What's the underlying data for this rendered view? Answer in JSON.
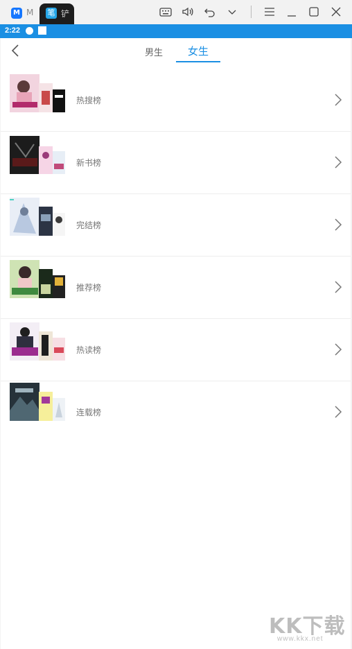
{
  "window": {
    "tab1_text": "M",
    "active_tab_icon": "笔",
    "active_tab_text": "铲"
  },
  "status": {
    "time": "2:22"
  },
  "header": {
    "tabs": [
      "男生",
      "女生"
    ],
    "active_tab": 1
  },
  "rankings": [
    {
      "label": "热搜榜"
    },
    {
      "label": "新书榜"
    },
    {
      "label": "完结榜"
    },
    {
      "label": "推荐榜"
    },
    {
      "label": "热读榜"
    },
    {
      "label": "连载榜"
    }
  ],
  "watermark": {
    "logo": "KK下载",
    "url": "www.kkx.net"
  },
  "colors": {
    "accent": "#1a8fe3",
    "divider": "#ededed",
    "label": "#777777"
  }
}
